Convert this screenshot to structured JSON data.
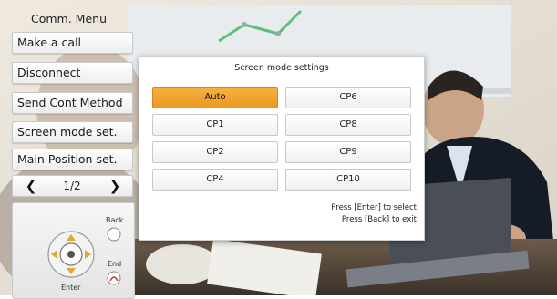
{
  "menu": {
    "title": "Comm. Menu",
    "items": [
      {
        "label": "Make a call"
      },
      {
        "label": "Disconnect"
      },
      {
        "label": "Send Cont Method"
      },
      {
        "label": "Screen mode set."
      },
      {
        "label": "Main Position set."
      }
    ],
    "pager": {
      "prev_icon": "chevron-left-icon",
      "page": "1/2",
      "next_icon": "chevron-right-icon"
    },
    "remote": {
      "back_label": "Back",
      "end_label": "End",
      "enter_label": "Enter"
    }
  },
  "dialog": {
    "title": "Screen mode settings",
    "options": [
      {
        "label": "Auto",
        "selected": true
      },
      {
        "label": "CP6",
        "selected": false
      },
      {
        "label": "CP1",
        "selected": false
      },
      {
        "label": "CP8",
        "selected": false
      },
      {
        "label": "CP2",
        "selected": false
      },
      {
        "label": "CP9",
        "selected": false
      },
      {
        "label": "CP4",
        "selected": false
      },
      {
        "label": "CP10",
        "selected": false
      }
    ],
    "hint_line1": "Press [Enter] to select",
    "hint_line2": "Press [Back] to exit"
  },
  "colors": {
    "selected": "#f0a52c",
    "accent_green": "#5cbf7a"
  }
}
